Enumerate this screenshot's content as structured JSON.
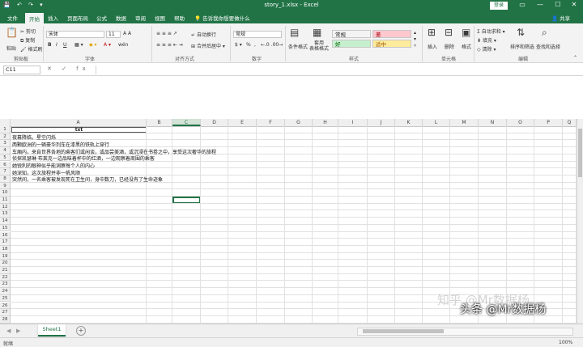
{
  "window": {
    "qat_icons": "💾 ↶ ↷ ▾",
    "title": "story_1.xlsx  -  Excel",
    "login_label": "登录",
    "controls": [
      "▭",
      "—",
      "☐",
      "✕"
    ]
  },
  "tabs": [
    "文件",
    "开始",
    "插入",
    "页面布局",
    "公式",
    "数据",
    "审阅",
    "视图",
    "帮助"
  ],
  "active_tab": "开始",
  "tellme_placeholder": "告诉我你想要做什么",
  "share_label": "共享",
  "ribbon": {
    "clipboard": {
      "paste": "粘贴",
      "cut": "剪切",
      "copy": "复制",
      "format_painter": "格式刷",
      "label": "剪贴板"
    },
    "font": {
      "name": "宋体",
      "size": "11",
      "bold": "B",
      "italic": "I",
      "underline": "U",
      "wen": "wén",
      "label": "字体"
    },
    "alignment": {
      "wrap": "自动换行",
      "merge": "合并后居中",
      "label": "对齐方式"
    },
    "number": {
      "format": "常规",
      "percent": "%",
      "comma": ",",
      "label": "数字"
    },
    "styles": {
      "conditional": "条件格式",
      "table": "套用\n表格格式",
      "cells": [
        {
          "text": "常规",
          "bg": "#ffffff",
          "fg": "#000000"
        },
        {
          "text": "差",
          "bg": "#ffc7ce",
          "fg": "#9c0006"
        },
        {
          "text": "好",
          "bg": "#c6efce",
          "fg": "#006100"
        },
        {
          "text": "适中",
          "bg": "#ffeb9c",
          "fg": "#9c5700"
        }
      ],
      "label": "样式"
    },
    "cells_group": {
      "insert": "插入",
      "delete": "删除",
      "format": "格式",
      "label": "单元格"
    },
    "editing": {
      "autosum": "自动求和",
      "fill": "填充",
      "clear": "清除",
      "sort": "排序和筛选",
      "find": "查找和选择",
      "label": "编辑"
    }
  },
  "formula_bar": {
    "name_box": "C11",
    "fx": "✕ ✓ fx",
    "value": ""
  },
  "grid": {
    "columns": [
      "A",
      "B",
      "C",
      "D",
      "E",
      "F",
      "G",
      "H",
      "I",
      "J",
      "K",
      "L",
      "M",
      "N",
      "O",
      "P",
      "Q"
    ],
    "selected_column": "C",
    "header_cell": "txt",
    "rows": [
      "夜幕降临，星空闪烁",
      "两颗欧洲的一辆豪华列车在漆黑的铁轨上穿行",
      "车厢内，来自世界各地的乘客们或闲谈，或品尝美酒，或沉浸在书卷之中，享受这次奢华的旅程",
      "侦探凯瑟琳·布莱克一边品味着杯中的红酒，一边观察着周围的乘客",
      "她锐利的眼神似乎能洞察每个人的内心",
      "她深知，这次旅程并非一帆风顺",
      "突然间，一名乘客被发现死在卫生间，身中数刀，已经没有了生命迹象"
    ],
    "row_numbers": [
      "1",
      "2",
      "3",
      "4",
      "5",
      "6",
      "7",
      "8",
      "9",
      "10",
      "11",
      "12",
      "13",
      "14",
      "15",
      "16",
      "17",
      "18",
      "19",
      "20",
      "21",
      "22",
      "23",
      "24",
      "25",
      "26",
      "27",
      "28"
    ],
    "active_cell": "C11"
  },
  "sheets": [
    "Sheet1"
  ],
  "add_sheet": "+",
  "status": {
    "ready": "就绪",
    "zoom": "100%"
  },
  "watermark": {
    "line1": "知乎 @Mr数据杨",
    "line2": "头条 @Mr数据杨"
  },
  "accent_color": "#217346"
}
